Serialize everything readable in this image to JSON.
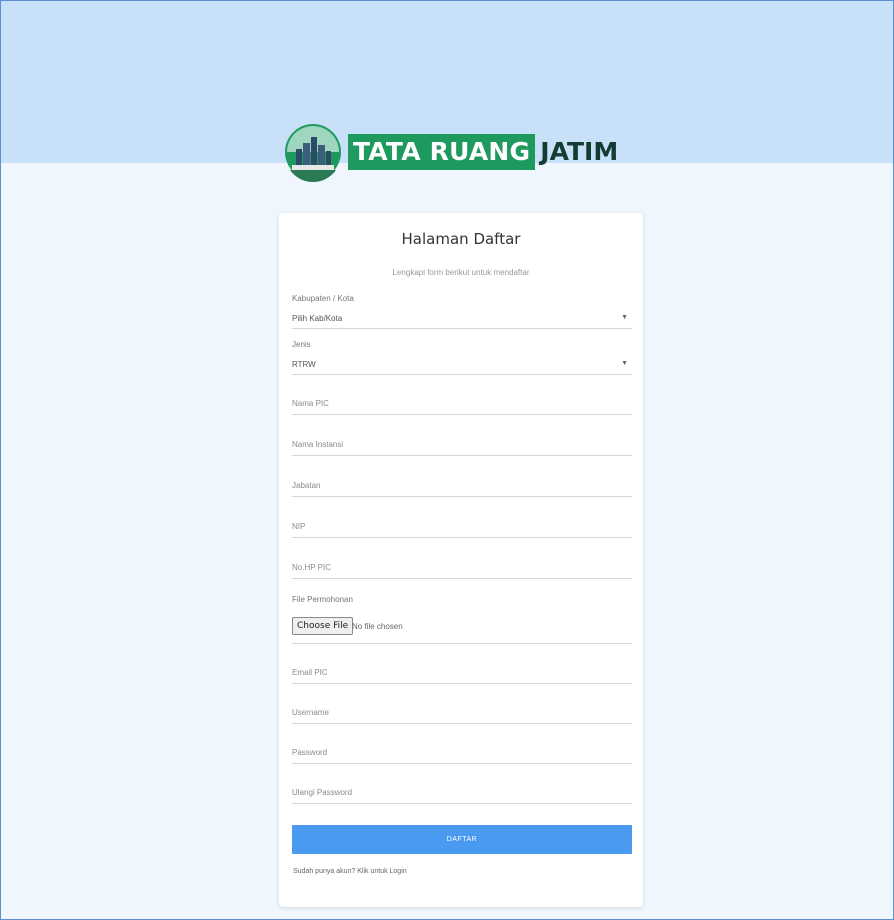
{
  "brand": {
    "name_part1": "TATA RUANG",
    "name_part2": "JATIM",
    "colors": {
      "green": "#1f9a5e",
      "dark": "#123d33",
      "band": "#c9e1f8",
      "page_bg": "#eff6fe"
    }
  },
  "form": {
    "title": "Halaman Daftar",
    "subtitle": "Lengkapi form berikut untuk mendaftar",
    "kabupaten": {
      "label": "Kabupaten / Kota",
      "value": "Pilih Kab/Kota"
    },
    "jenis": {
      "label": "Jenis",
      "value": "RTRW"
    },
    "fields": {
      "nama_pic": "Nama PIC",
      "nama_instansi": "Nama Instansi",
      "jabatan": "Jabatan",
      "nip": "NIP",
      "no_hp": "No.HP PIC",
      "email": "Email PIC",
      "username": "Username",
      "password": "Password",
      "ulangi_password": "Ulangi Password"
    },
    "file": {
      "label": "File Permohonan",
      "button": "Choose File",
      "status": "No file chosen"
    },
    "submit_label": "DAFTAR",
    "login_text": "Sudah punya akun? Klik untuk Login",
    "accent_color": "#4a9af2"
  }
}
